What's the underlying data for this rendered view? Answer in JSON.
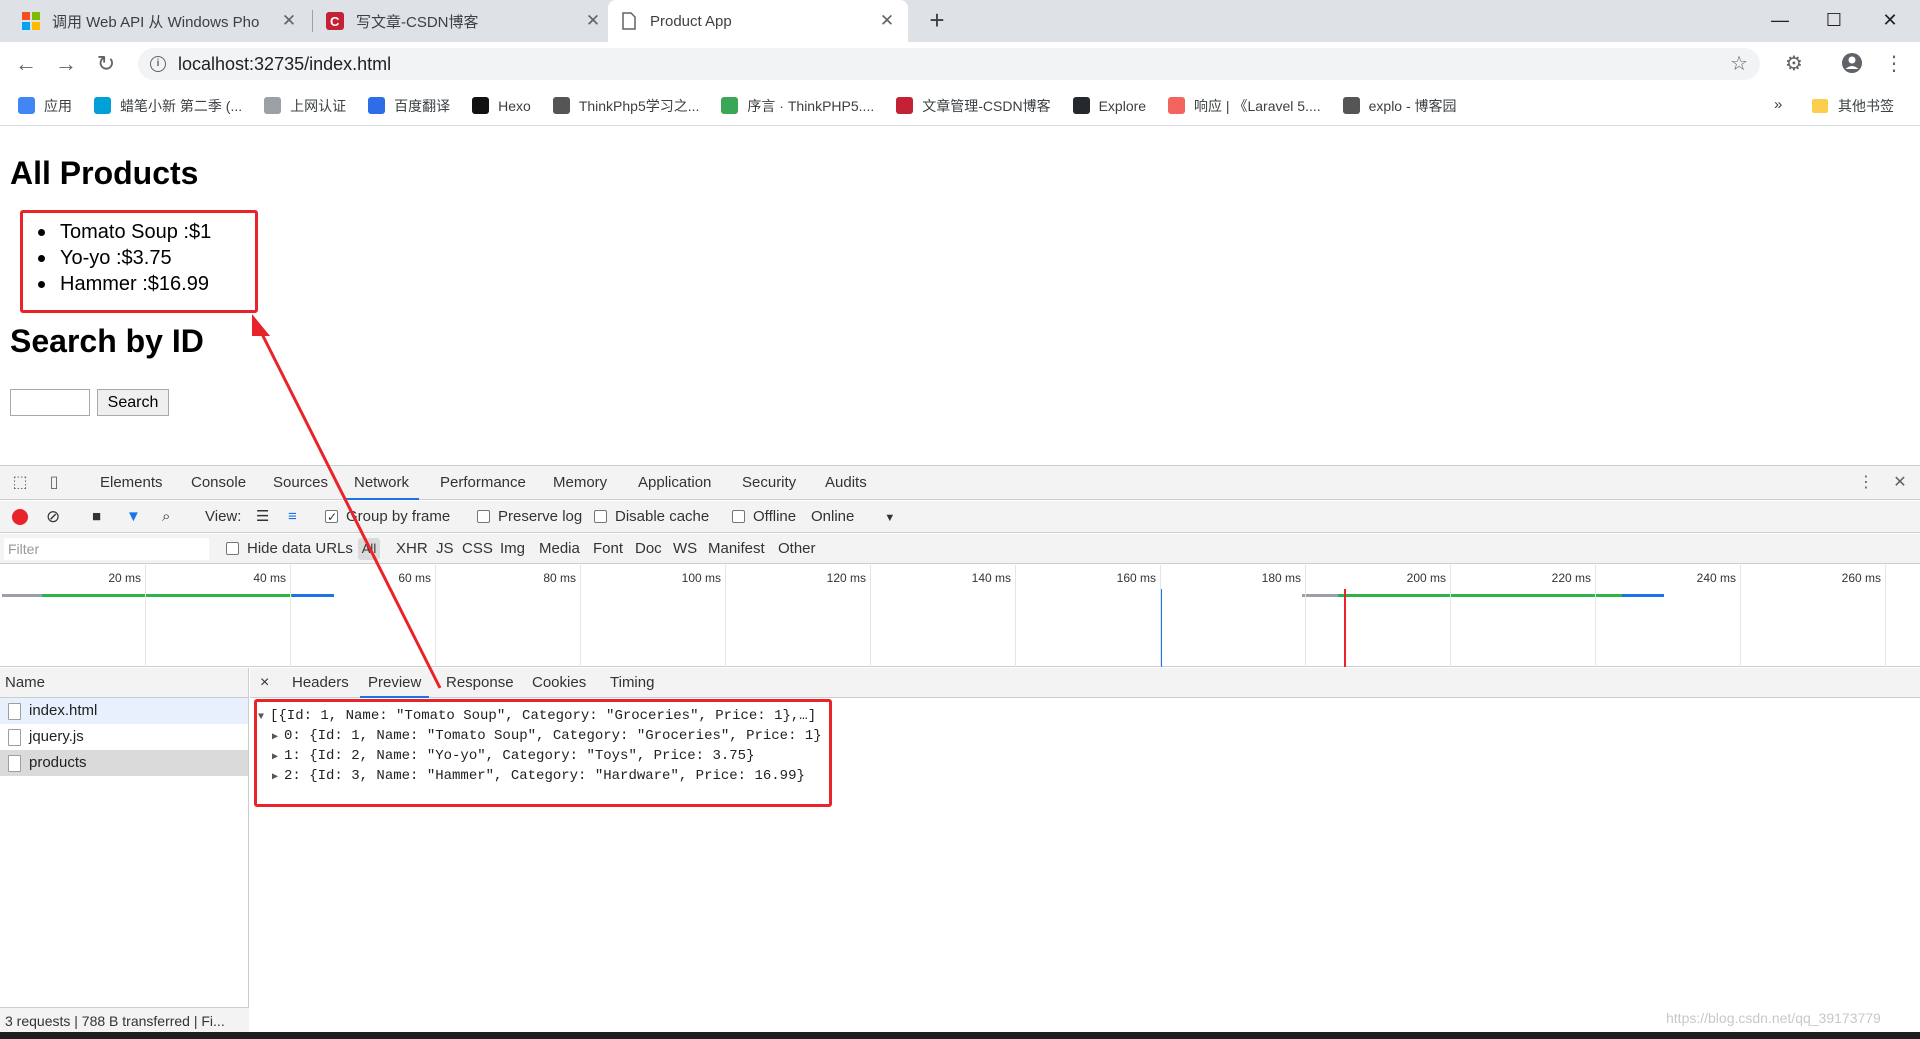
{
  "tabs": [
    {
      "title": "调用 Web API 从 Windows Pho",
      "close": "✕"
    },
    {
      "title": "写文章-CSDN博客",
      "close": "✕"
    },
    {
      "title": "Product App",
      "close": "✕"
    }
  ],
  "newtab": "+",
  "window": {
    "minimize": "—",
    "maximize": "☐",
    "close": "✕"
  },
  "toolbar": {
    "url": "localhost:32735/index.html"
  },
  "bookmarks": [
    {
      "label": "应用",
      "color": "#4285f4"
    },
    {
      "label": "蜡笔小新 第二季 (...",
      "color": "#00a1d6"
    },
    {
      "label": "上网认证",
      "color": "#9aa0a6"
    },
    {
      "label": "百度翻译",
      "color": "#2d6ee7"
    },
    {
      "label": "Hexo",
      "color": "#111111"
    },
    {
      "label": "ThinkPhp5学习之...",
      "color": "#555555"
    },
    {
      "label": "序言 · ThinkPHP5....",
      "color": "#3aa757"
    },
    {
      "label": "文章管理-CSDN博客",
      "color": "#c32136"
    },
    {
      "label": "Explore",
      "color": "#24292e"
    },
    {
      "label": "响应 | 《Laravel 5....",
      "color": "#f4645f"
    },
    {
      "label": "explo - 博客园",
      "color": "#555555"
    }
  ],
  "bookmarks_more": "»",
  "bookmarks_other": "其他书签",
  "page": {
    "heading": "All Products",
    "products": [
      "Tomato Soup :$1",
      "Yo-yo :$3.75",
      "Hammer :$16.99"
    ],
    "search_heading": "Search by ID",
    "search_button": "Search"
  },
  "devtools": {
    "tabs": [
      "Elements",
      "Console",
      "Sources",
      "Network",
      "Performance",
      "Memory",
      "Application",
      "Security",
      "Audits"
    ],
    "active_tab": "Network",
    "toolbar": {
      "view": "View:",
      "group_by_frame": "Group by frame",
      "preserve_log": "Preserve log",
      "disable_cache": "Disable cache",
      "offline": "Offline",
      "online": "Online"
    },
    "filter_placeholder": "Filter",
    "hide_data_urls": "Hide data URLs",
    "types": [
      "All",
      "XHR",
      "JS",
      "CSS",
      "Img",
      "Media",
      "Font",
      "Doc",
      "WS",
      "Manifest",
      "Other"
    ],
    "timeline_ticks": [
      "20 ms",
      "40 ms",
      "60 ms",
      "80 ms",
      "100 ms",
      "120 ms",
      "140 ms",
      "160 ms",
      "180 ms",
      "200 ms",
      "220 ms",
      "240 ms",
      "260 ms"
    ],
    "name_header": "Name",
    "files": [
      "index.html",
      "jquery.js",
      "products"
    ],
    "status": "3 requests  |  788 B transferred  |  Fi...",
    "detail_tabs": [
      "Headers",
      "Preview",
      "Response",
      "Cookies",
      "Timing"
    ],
    "detail_close": "×",
    "preview_lines": [
      "[{Id: 1, Name: \"Tomato Soup\", Category: \"Groceries\", Price: 1},…]",
      "0: {Id: 1, Name: \"Tomato Soup\", Category: \"Groceries\", Price: 1}",
      "1: {Id: 2, Name: \"Yo-yo\", Category: \"Toys\", Price: 3.75}",
      "2: {Id: 3, Name: \"Hammer\", Category: \"Hardware\", Price: 16.99}"
    ]
  },
  "watermark": "https://blog.csdn.net/qq_39173779",
  "colors": {
    "annotation": "#e8242a",
    "accent": "#1a73e8",
    "green": "#2db34a"
  }
}
